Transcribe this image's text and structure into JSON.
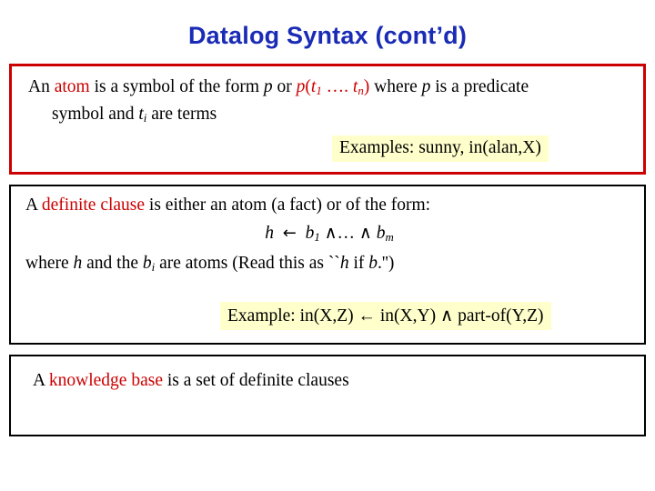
{
  "slide": {
    "title": "Datalog Syntax (cont’d)",
    "atom_box": {
      "line1_pre": "An ",
      "keyword": "atom",
      "line1_mid": " is a symbol of the form ",
      "p1": "p",
      "line1_or": " or ",
      "p2": "p",
      "paren_open": "(",
      "t1": "t",
      "t1_sub": "1",
      "dots": " …. ",
      "tn": "t",
      "tn_sub": "n",
      "paren_close": ")",
      "line1_post": " where ",
      "p3": "p",
      "line1_end": " is a predicate",
      "line2_pre": "symbol and ",
      "ti": "t",
      "ti_sub": "i",
      "line2_post": " are terms",
      "example": "Examples: sunny,  in(alan,X)"
    },
    "clause_box": {
      "line1_pre": "A ",
      "keyword": "definite clause",
      "line1_post": " is either an atom (a fact) or of the form:",
      "formula_h": "h",
      "formula_arrow": "←",
      "formula_b1": "b",
      "formula_b1_sub": "1",
      "formula_wedge1": "∧",
      "formula_dots": "…",
      "formula_wedge2": "∧",
      "formula_bm": "b",
      "formula_bm_sub": "m",
      "line3_pre": "where ",
      "line3_h": "h",
      "line3_mid": " and the ",
      "line3_b": "b",
      "line3_b_sub": "i",
      "line3_post": " are atoms (Read this as ``",
      "line3_h2": "h",
      "line3_if": " if ",
      "line3_b2": "b",
      "line3_end": ".'')",
      "example": "Example: in(X,Z) ← in(X,Y) ∧ part-of(Y,Z)"
    },
    "kb_box": {
      "line_pre": "A ",
      "keyword": "knowledge base",
      "line_post": " is a set of definite clauses"
    }
  },
  "colors": {
    "title": "#1a2bb5",
    "keyword": "#cc0000",
    "atom_border": "#cc0000",
    "box_border": "#000000",
    "highlight_bg": "#ffffcc"
  }
}
